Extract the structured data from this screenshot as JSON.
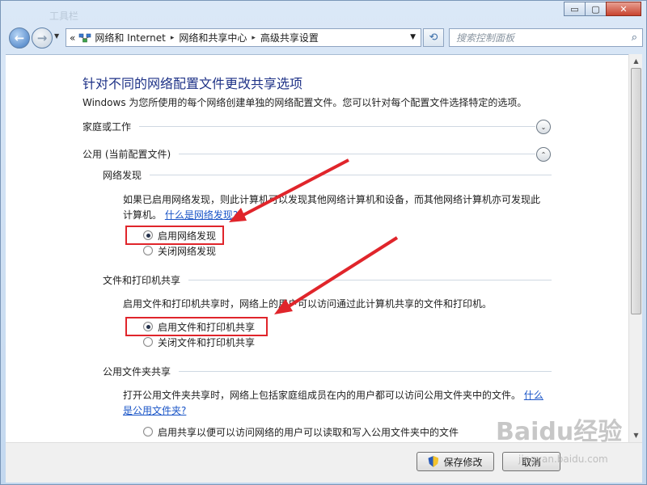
{
  "window": {
    "faded_title": "工具栏",
    "minimize": "▭",
    "maximize": "▢",
    "close": "✕"
  },
  "nav": {
    "back": "←",
    "forward": "→",
    "history_dropdown": "▼",
    "address_prefix": "«",
    "breadcrumbs": [
      "网络和 Internet",
      "网络和共享中心",
      "高级共享设置"
    ],
    "breadcrumb_separator": "▸",
    "address_dropdown": "▼",
    "refresh": "⟲",
    "search_placeholder": "搜索控制面板",
    "search_icon": "⌕"
  },
  "content": {
    "title": "针对不同的网络配置文件更改共享选项",
    "description": "Windows 为您所使用的每个网络创建单独的网络配置文件。您可以针对每个配置文件选择特定的选项。",
    "profiles": [
      {
        "label": "家庭或工作",
        "toggle": "⌄"
      },
      {
        "label": "公用 (当前配置文件)",
        "toggle": "⌃"
      }
    ],
    "network_discovery": {
      "header": "网络发现",
      "para_line1": "如果已启用网络发现，则此计算机可以发现其他网络计算机和设备，而其他网络计算机亦可发现此",
      "para_line2": "计算机。",
      "link": "什么是网络发现?",
      "option_on": "启用网络发现",
      "option_off": "关闭网络发现"
    },
    "file_printer_sharing": {
      "header": "文件和打印机共享",
      "para": "启用文件和打印机共享时，网络上的用户可以访问通过此计算机共享的文件和打印机。",
      "option_on": "启用文件和打印机共享",
      "option_off": "关闭文件和打印机共享"
    },
    "public_folder_sharing": {
      "header": "公用文件夹共享",
      "para": "打开公用文件夹共享时，网络上包括家庭组成员在内的用户都可以访问公用文件夹中的文件。",
      "link_part1": "什么",
      "link_part2": "是公用文件夹?",
      "option_on": "启用共享以便可以访问网络的用户可以读取和写入公用文件夹中的文件"
    }
  },
  "footer": {
    "save_label": "保存修改",
    "cancel_label": "取消"
  },
  "watermark": {
    "text": "Baidu经验",
    "sub": "jingyan.baidu.com"
  },
  "colors": {
    "title": "#1e3287",
    "link": "#1a55c7",
    "highlight": "#e0252b"
  }
}
